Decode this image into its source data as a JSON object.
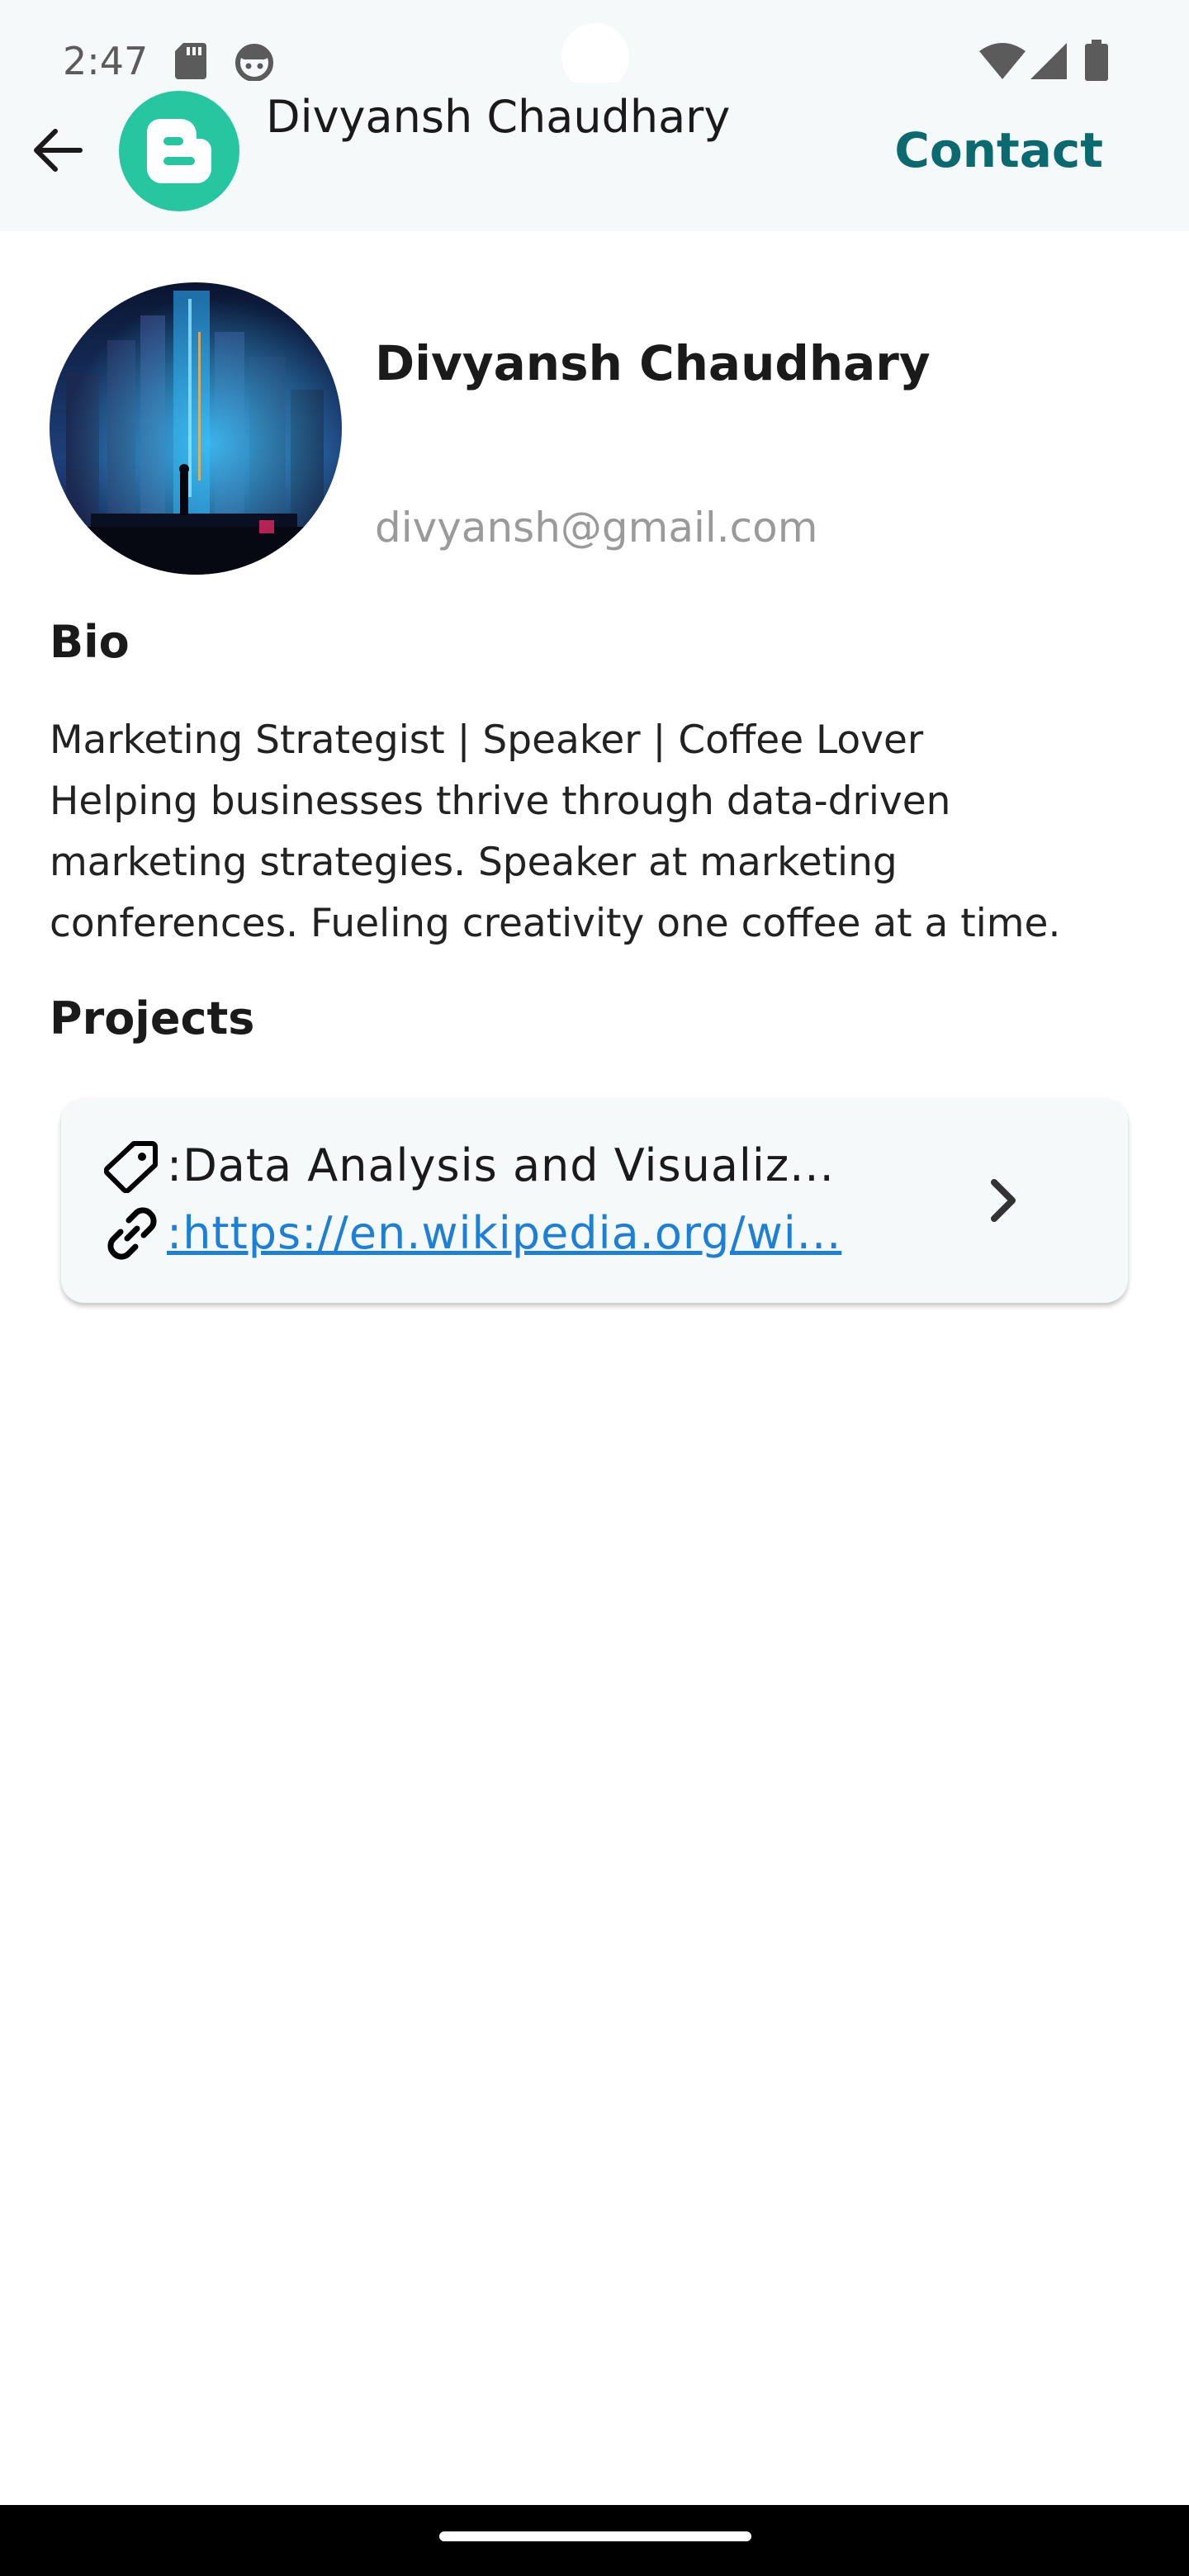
{
  "status_bar": {
    "time": "2:47",
    "icons": [
      "sd-card-icon",
      "android-icon",
      "wifi-icon",
      "cell-signal-icon",
      "battery-icon"
    ]
  },
  "app_bar": {
    "title": "Divyansh Chaudhary",
    "contact_label": "Contact",
    "logo_icon": "blogger-logo-icon",
    "logo_color": "#26c6a0",
    "contact_color": "#0b6a70"
  },
  "profile": {
    "name": "Divyansh Chaudhary",
    "email": "divyansh@gmail.com"
  },
  "bio": {
    "title": "Bio",
    "text": "Marketing Strategist | Speaker | Coffee Lover\nHelping businesses thrive through data-driven\nmarketing strategies. Speaker at marketing\nconferences. Fueling creativity one coffee at a time."
  },
  "projects": {
    "title": "Projects",
    "items": [
      {
        "name": ":Data Analysis and Visualiz...",
        "link": ":https://en.wikipedia.org/wi..."
      }
    ]
  },
  "colors": {
    "link": "#1e7fd6",
    "app_bar_bg": "#f6f9fa"
  }
}
